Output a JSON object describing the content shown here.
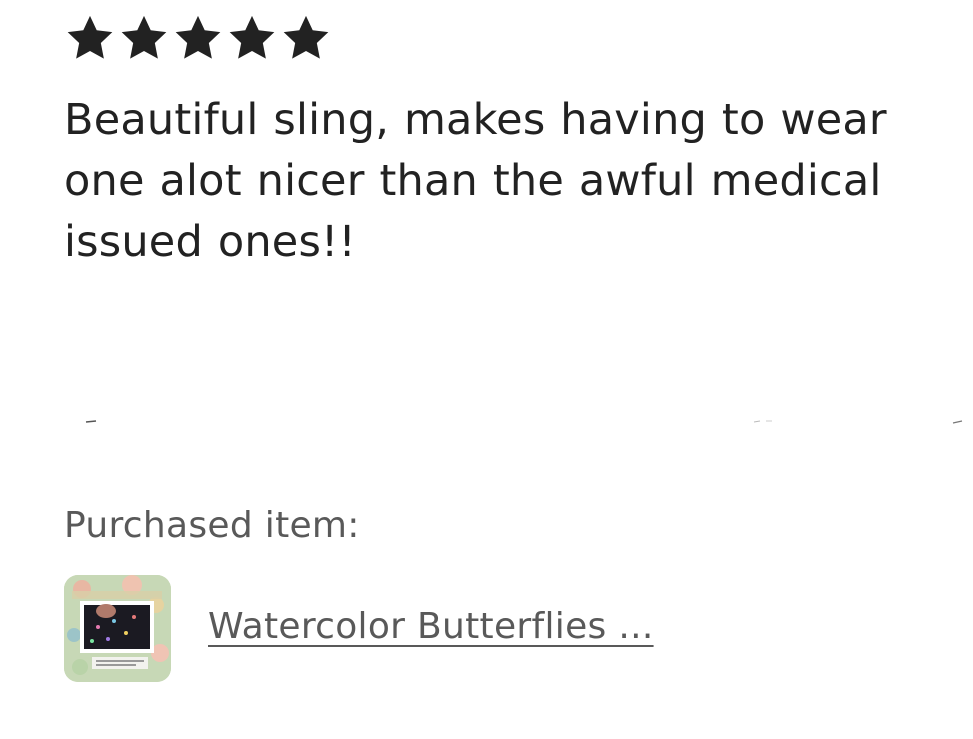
{
  "review": {
    "rating": 5,
    "rating_max": 5,
    "text": "Beautiful sling, makes having to wear one alot nicer than the awful medical issued ones!!"
  },
  "purchase": {
    "label": "Purchased item:",
    "item_title": "Watercolor Butterflies ...",
    "thumbnail_icon": "product-thumbnail"
  },
  "colors": {
    "text": "#222222",
    "muted_text": "#595959",
    "star": "#222222"
  }
}
